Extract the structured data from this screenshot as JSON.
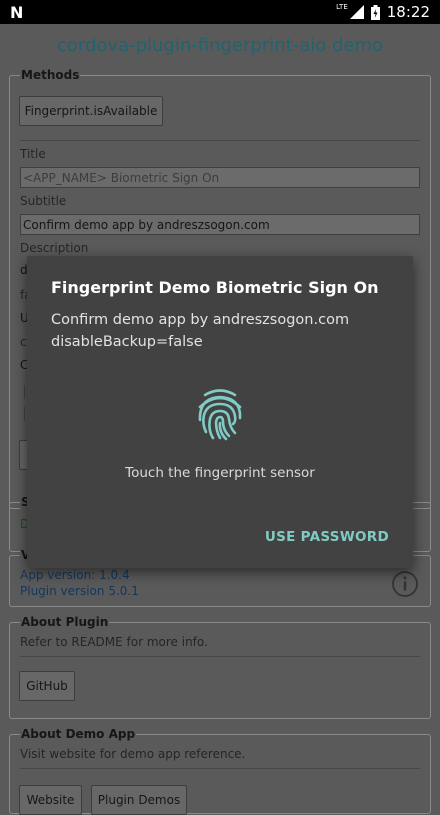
{
  "status_bar": {
    "network": "LTE",
    "time": "18:22"
  },
  "app": {
    "title": "cordova-plugin-fingerprint-aio demo"
  },
  "methods": {
    "legend": "Methods",
    "is_available_button": "Fingerprint.isAvailable",
    "title_label": "Title",
    "title_placeholder": "<APP_NAME> Biometric Sign On",
    "subtitle_label": "Subtitle",
    "subtitle_value": "Confirm demo app by andreszsogon.com",
    "description_label": "Description",
    "description_value_partial": "d",
    "fallback_label_partial": "fa",
    "fallback_value_partial": "U",
    "cancel_label_partial": "c",
    "cancel_value_partial": "C"
  },
  "status_section": {
    "legend_partial": "S",
    "value_partial": "D"
  },
  "version_section": {
    "legend_partial": "V",
    "app_version": "App version: 1.0.4",
    "plugin_version": "Plugin version 5.0.1"
  },
  "about_plugin": {
    "legend": "About Plugin",
    "text": "Refer to README for more info.",
    "github_button": "GitHub"
  },
  "about_demo": {
    "legend": "About Demo App",
    "text": "Visit website for demo app reference.",
    "website_button": "Website",
    "plugin_demos_button": "Plugin Demos"
  },
  "dialog": {
    "title": "Fingerprint Demo Biometric Sign On",
    "description": "Confirm demo app by andreszsogon.com\ndisableBackup=false",
    "status": "Touch the fingerprint sensor",
    "action": "USE PASSWORD",
    "accent_color": "#80cbc4",
    "icon": "fingerprint-icon"
  }
}
